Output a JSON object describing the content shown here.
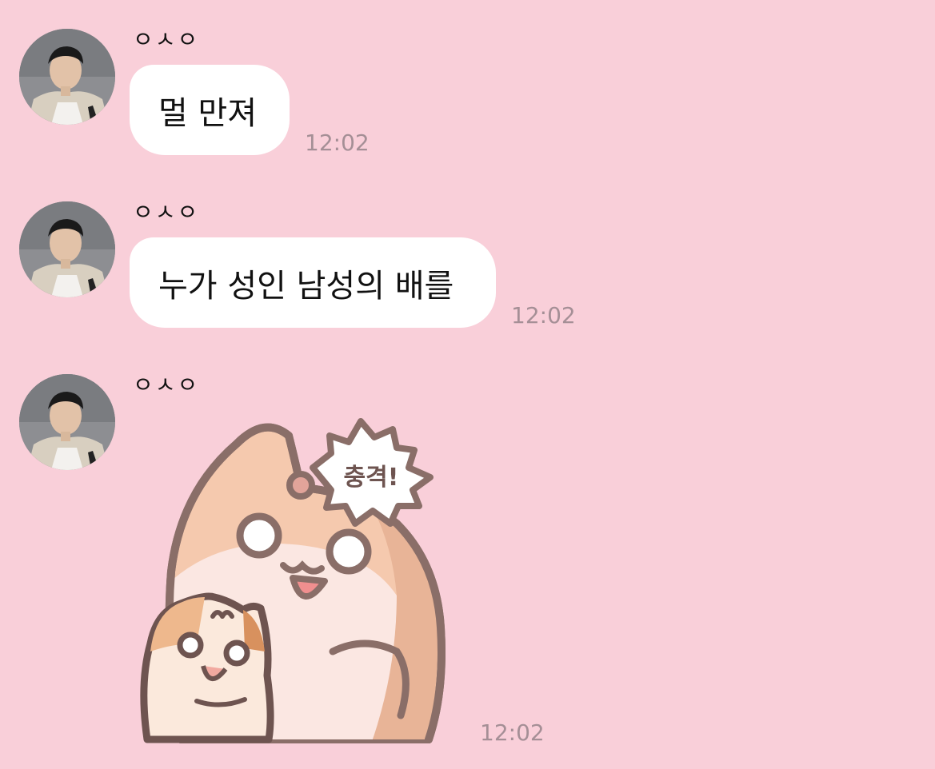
{
  "colors": {
    "background": "#f9cfd9",
    "bubble": "#ffffff",
    "timestamp": "#a58f96"
  },
  "messages": [
    {
      "sender": "ㅇㅅㅇ",
      "avatar_icon": "profile-photo",
      "type": "text",
      "text": "멀 만져",
      "time": "12:02"
    },
    {
      "sender": "ㅇㅅㅇ",
      "avatar_icon": "profile-photo",
      "type": "text",
      "text": "누가 성인 남성의 배를",
      "time": "12:02"
    },
    {
      "sender": "ㅇㅅㅇ",
      "avatar_icon": "profile-photo",
      "type": "sticker",
      "sticker_icon": "cat-sticker",
      "sticker_text": "충격!",
      "time": "12:02"
    }
  ]
}
